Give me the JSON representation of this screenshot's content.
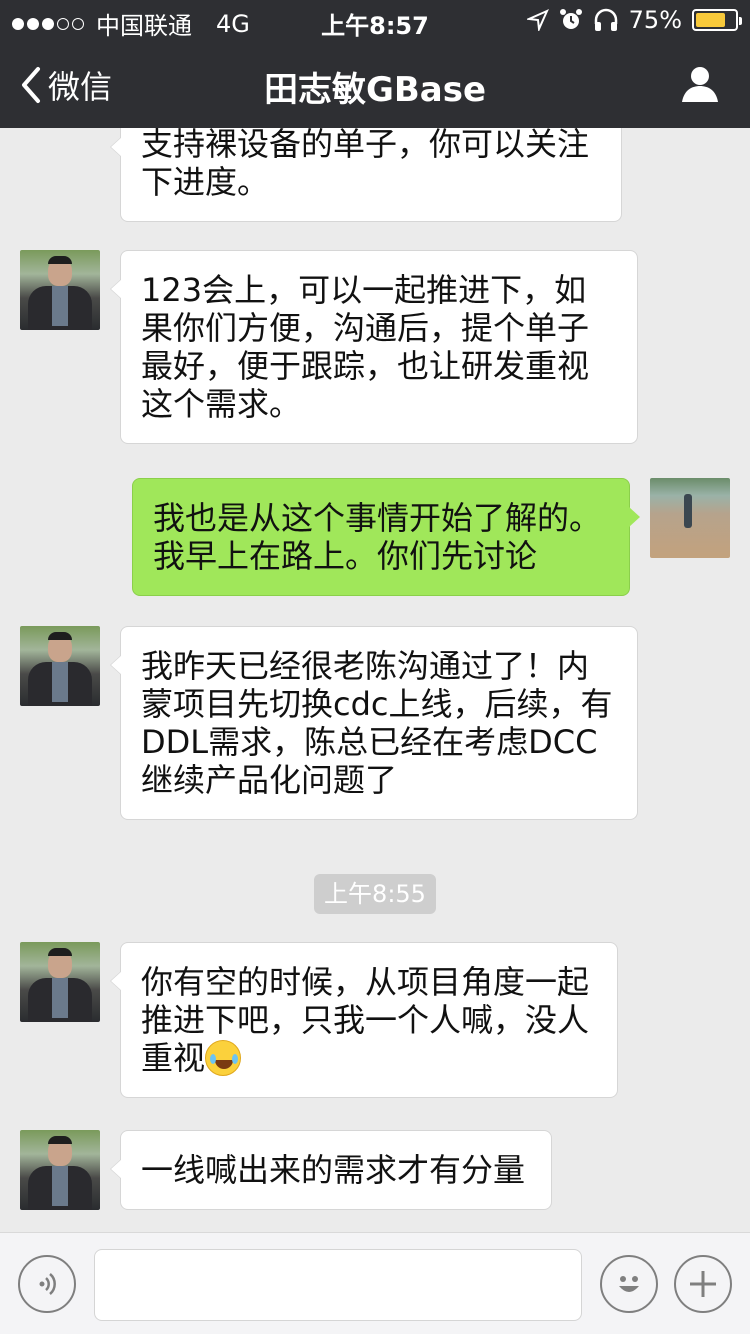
{
  "status_bar": {
    "carrier": "中国联通",
    "network": "4G",
    "time": "上午8:57",
    "battery_percent": "75%",
    "battery_level": 0.75,
    "icons": [
      "location-arrow-icon",
      "alarm-icon",
      "headphones-icon",
      "battery-icon"
    ]
  },
  "nav": {
    "back_label": "微信",
    "title": "田志敏GBase",
    "right_icon": "person-icon"
  },
  "messages": [
    {
      "side": "left",
      "text": "支持裸设备的单子，你可以关注下进度。"
    },
    {
      "side": "left",
      "text": "123会上，可以一起推进下，如果你们方便，沟通后，提个单子最好，便于跟踪，也让研发重视这个需求。"
    },
    {
      "side": "right",
      "text": "我也是从这个事情开始了解的。我早上在路上。你们先讨论"
    },
    {
      "side": "left",
      "text": "我昨天已经很老陈沟通过了！内蒙项目先切换cdc上线，后续，有DDL需求，陈总已经在考虑DCC继续产品化问题了"
    },
    {
      "side": "left",
      "text": "你有空的时候，从项目角度一起推进下吧，只我一个人喊，没人重视",
      "emoji": "tears-of-joy-emoji"
    },
    {
      "side": "left",
      "text": "一线喊出来的需求才有分量"
    }
  ],
  "timestamp": "上午8:55",
  "colors": {
    "nav_bg": "#2e2f33",
    "chat_bg": "#ebebeb",
    "sent_bubble": "#a0e75a",
    "received_bubble": "#ffffff",
    "battery_fill": "#f8c93b"
  },
  "input_bar": {
    "voice_icon": "voice-icon",
    "emoji_icon": "emoji-icon",
    "plus_icon": "plus-icon"
  }
}
